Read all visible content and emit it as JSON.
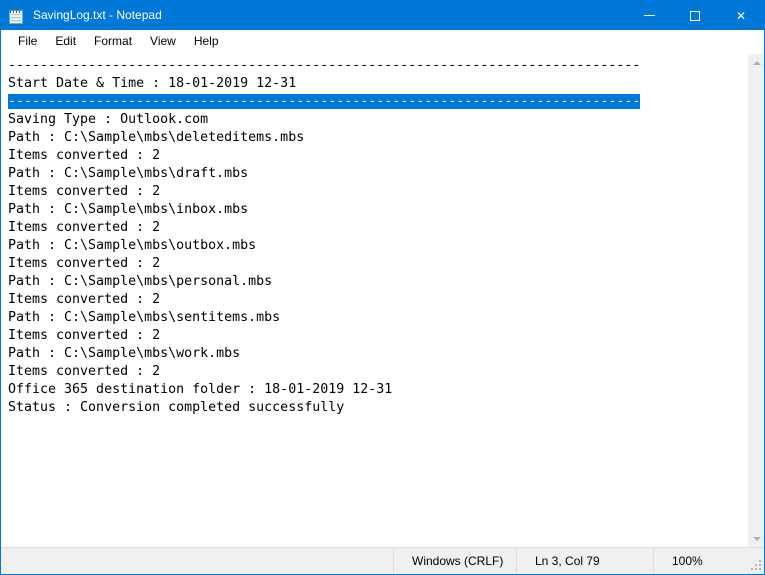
{
  "window": {
    "title": "SavingLog.txt - Notepad",
    "icon": "notepad-icon",
    "accent_color": "#0078d7",
    "controls": {
      "minimize": "–",
      "maximize": "□",
      "close": "✕"
    }
  },
  "menubar": {
    "items": [
      {
        "label": "File"
      },
      {
        "label": "Edit"
      },
      {
        "label": "Format"
      },
      {
        "label": "View"
      },
      {
        "label": "Help"
      }
    ]
  },
  "editor": {
    "lines": [
      {
        "text": "-------------------------------------------------------------------------------",
        "selected": false
      },
      {
        "text": "Start Date & Time : 18-01-2019 12-31",
        "selected": false
      },
      {
        "text": "-------------------------------------------------------------------------------",
        "selected": true
      },
      {
        "text": "Saving Type : Outlook.com",
        "selected": false
      },
      {
        "text": "Path : C:\\Sample\\mbs\\deleteditems.mbs",
        "selected": false
      },
      {
        "text": "Items converted : 2",
        "selected": false
      },
      {
        "text": "Path : C:\\Sample\\mbs\\draft.mbs",
        "selected": false
      },
      {
        "text": "Items converted : 2",
        "selected": false
      },
      {
        "text": "Path : C:\\Sample\\mbs\\inbox.mbs",
        "selected": false
      },
      {
        "text": "Items converted : 2",
        "selected": false
      },
      {
        "text": "Path : C:\\Sample\\mbs\\outbox.mbs",
        "selected": false
      },
      {
        "text": "Items converted : 2",
        "selected": false
      },
      {
        "text": "Path : C:\\Sample\\mbs\\personal.mbs",
        "selected": false
      },
      {
        "text": "Items converted : 2",
        "selected": false
      },
      {
        "text": "Path : C:\\Sample\\mbs\\sentitems.mbs",
        "selected": false
      },
      {
        "text": "Items converted : 2",
        "selected": false
      },
      {
        "text": "Path : C:\\Sample\\mbs\\work.mbs",
        "selected": false
      },
      {
        "text": "Items converted : 2",
        "selected": false
      },
      {
        "text": "Office 365 destination folder : 18-01-2019 12-31",
        "selected": false
      },
      {
        "text": "Status : Conversion completed successfully",
        "selected": false
      }
    ],
    "selection_color": "#0078d7"
  },
  "scrollbar": {
    "up_arrow": "scroll-up-arrow-icon",
    "down_arrow": "scroll-down-arrow-icon"
  },
  "statusbar": {
    "line_ending": "Windows (CRLF)",
    "cursor_position": "Ln 3, Col 79",
    "zoom": "100%"
  }
}
